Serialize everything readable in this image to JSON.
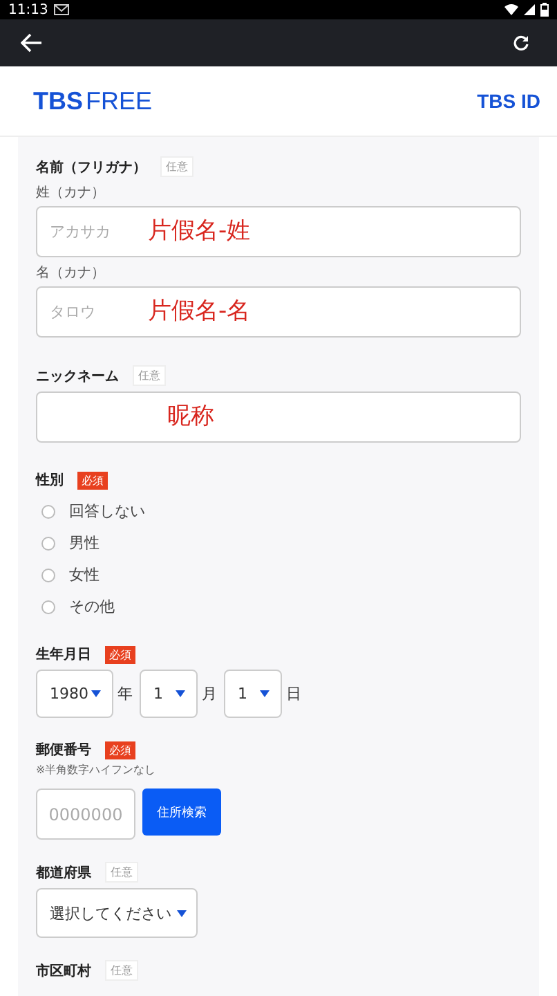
{
  "status_bar": {
    "time": "11:13"
  },
  "header": {
    "logo_bold": "TBS",
    "logo_light": "FREE",
    "brand_link": "TBS ID"
  },
  "form": [
    {
      "kind": "names",
      "label": "名前（フリガナ）",
      "badge": {
        "text": "任意",
        "required": false
      },
      "fields": [
        {
          "label": "姓（カナ）",
          "placeholder": "アカサカ",
          "annotation": "片假名-姓"
        },
        {
          "label": "名（カナ）",
          "placeholder": "タロウ",
          "annotation": "片假名-名"
        }
      ]
    },
    {
      "kind": "text",
      "label": "ニックネーム",
      "badge": {
        "text": "任意",
        "required": false
      },
      "annotation": "昵称"
    },
    {
      "kind": "radio",
      "label": "性別",
      "badge": {
        "text": "必須",
        "required": true
      },
      "options": [
        {
          "label": "回答しない",
          "selected": false
        },
        {
          "label": "男性",
          "selected": false
        },
        {
          "label": "女性",
          "selected": false
        },
        {
          "label": "その他",
          "selected": false
        }
      ]
    },
    {
      "kind": "date",
      "label": "生年月日",
      "badge": {
        "text": "必須",
        "required": true
      },
      "parts": [
        {
          "value": "1980",
          "unit": "年"
        },
        {
          "value": "1",
          "unit": "月"
        },
        {
          "value": "1",
          "unit": "日"
        }
      ]
    },
    {
      "kind": "zip",
      "label": "郵便番号",
      "badge": {
        "text": "必須",
        "required": true
      },
      "hint": "※半角数字ハイフンなし",
      "placeholder": "0000000",
      "button": "住所検索"
    },
    {
      "kind": "select",
      "label": "都道府県",
      "badge": {
        "text": "任意",
        "required": false
      },
      "value": "選択してください"
    },
    {
      "kind": "heading",
      "label": "市区町村",
      "badge": {
        "text": "任意",
        "required": false
      }
    }
  ]
}
